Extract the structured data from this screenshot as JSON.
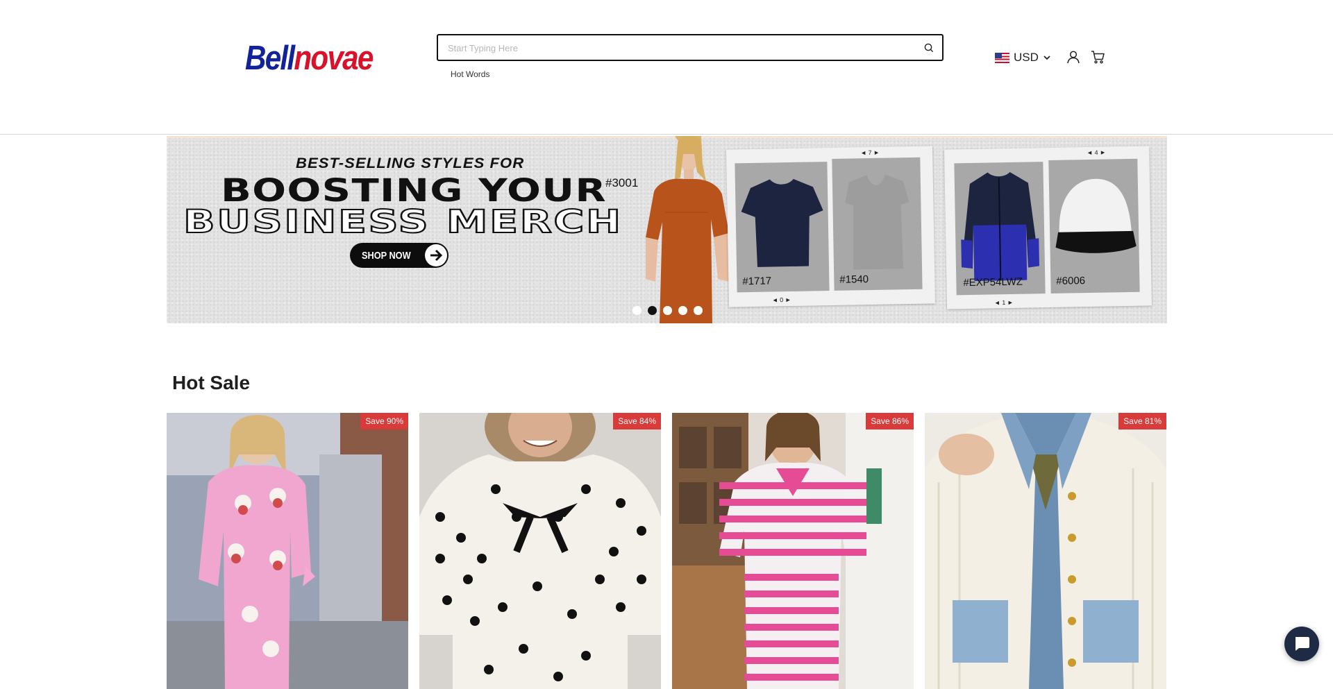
{
  "header": {
    "logo": {
      "part1": "Bell",
      "part2": "novae"
    },
    "search": {
      "placeholder": "Start Typing Here",
      "value": ""
    },
    "hot_words_label": "Hot Words",
    "currency": {
      "code": "USD",
      "flag_icon": "us-flag-icon"
    },
    "icons": [
      "search-icon",
      "chevron-down-icon",
      "user-icon",
      "cart-icon"
    ]
  },
  "banner": {
    "kicker": "BEST-SELLING STYLES FOR",
    "headline_line1": "BOOSTING YOUR",
    "headline_line2": "BUSINESS MERCH",
    "cta_label": "SHOP NOW",
    "model_code": "#3001",
    "products": [
      {
        "code": "#1717",
        "color": "#1c2440"
      },
      {
        "code": "#1540",
        "color": "#9d9d9d"
      },
      {
        "code": "#EXP54LWZ",
        "color": "#2b2fb0"
      },
      {
        "code": "#6006",
        "color": "#f2f2f2"
      }
    ],
    "card_nav": [
      "◄ 7 ►",
      "◄ 0 ►",
      "◄ 4 ►",
      "◄ 1 ►"
    ],
    "slides_total": 5,
    "active_slide": 2
  },
  "hot_sale": {
    "title": "Hot Sale",
    "products": [
      {
        "badge": "Save 90%",
        "palette": "pink-pajamas"
      },
      {
        "badge": "Save 84%",
        "palette": "polka-dot-top"
      },
      {
        "badge": "Save 86%",
        "palette": "pink-stripe-set"
      },
      {
        "badge": "Save 81%",
        "palette": "cream-denim-cardigan"
      }
    ]
  },
  "colors": {
    "brand_blue": "#12239a",
    "brand_red": "#d9122b",
    "badge_red": "#d93b3b",
    "chat_bg": "#1f2a44"
  }
}
